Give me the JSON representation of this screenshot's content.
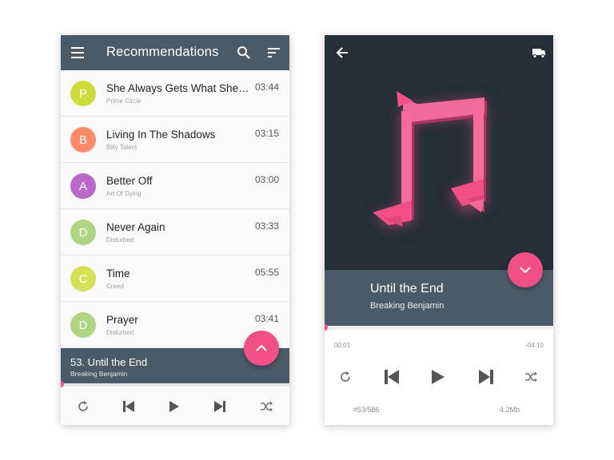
{
  "left": {
    "title": "Recommendations",
    "icons": [
      "menu-icon",
      "search-icon",
      "sort-icon"
    ],
    "songs": [
      {
        "letter": "P",
        "title": "She Always Gets What She Wants",
        "artist": "Prime Circle",
        "duration": "03:44",
        "color": "#cddc39"
      },
      {
        "letter": "B",
        "title": "Living In The Shadows",
        "artist": "Billy Talent",
        "duration": "03:15",
        "color": "#ff8a65"
      },
      {
        "letter": "A",
        "title": "Better Off",
        "artist": "Art Of Dying",
        "duration": "03:00",
        "color": "#ba68c8"
      },
      {
        "letter": "D",
        "title": "Never Again",
        "artist": "Disturbed",
        "duration": "03:33",
        "color": "#aed581"
      },
      {
        "letter": "C",
        "title": "Time",
        "artist": "Creed",
        "duration": "05:55",
        "color": "#d4e157"
      },
      {
        "letter": "D",
        "title": "Prayer",
        "artist": "Disturbed",
        "duration": "03:41",
        "color": "#aed581"
      }
    ],
    "now_playing": {
      "title": "53. Until the End",
      "artist": "Breaking Benjamin"
    },
    "controls": [
      "repeat-icon",
      "previous-icon",
      "play-icon",
      "next-icon",
      "shuffle-icon"
    ],
    "progress": 0
  },
  "right": {
    "icons": [
      "back-arrow-icon",
      "truck-icon"
    ],
    "track": {
      "title": "Until the End",
      "artist": "Breaking Benjamin"
    },
    "elapsed": "00:01",
    "remaining": "-04:10",
    "position": "#53/586",
    "size": "4.2Mb",
    "controls": [
      "repeat-icon",
      "previous-icon",
      "play-icon",
      "next-icon",
      "shuffle-icon"
    ],
    "progress": 0,
    "colors": {
      "accent": "#f14f85",
      "art_bg": "#252f36",
      "bar": "#4a5b67"
    }
  }
}
